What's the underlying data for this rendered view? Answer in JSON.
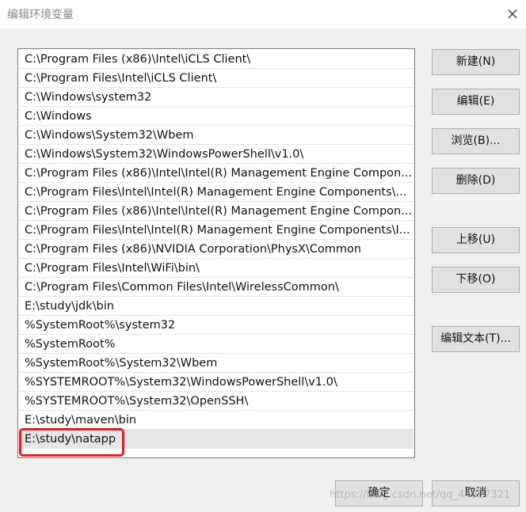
{
  "window": {
    "title": "编辑环境变量",
    "close_glyph": "×"
  },
  "paths": [
    "C:\\Program Files (x86)\\Intel\\iCLS Client\\",
    "C:\\Program Files\\Intel\\iCLS Client\\",
    "C:\\Windows\\system32",
    "C:\\Windows",
    "C:\\Windows\\System32\\Wbem",
    "C:\\Windows\\System32\\WindowsPowerShell\\v1.0\\",
    "C:\\Program Files (x86)\\Intel\\Intel(R) Management Engine Compon...",
    "C:\\Program Files\\Intel\\Intel(R) Management Engine Components\\...",
    "C:\\Program Files (x86)\\Intel\\Intel(R) Management Engine Compon...",
    "C:\\Program Files\\Intel\\Intel(R) Management Engine Components\\I...",
    "C:\\Program Files (x86)\\NVIDIA Corporation\\PhysX\\Common",
    "C:\\Program Files\\Intel\\WiFi\\bin\\",
    "C:\\Program Files\\Common Files\\Intel\\WirelessCommon\\",
    "E:\\study\\jdk\\bin",
    "%SystemRoot%\\system32",
    "%SystemRoot%",
    "%SystemRoot%\\System32\\Wbem",
    "%SYSTEMROOT%\\System32\\WindowsPowerShell\\v1.0\\",
    "%SYSTEMROOT%\\System32\\OpenSSH\\",
    "E:\\study\\maven\\bin",
    "E:\\study\\natapp"
  ],
  "selected_index": 20,
  "buttons": {
    "new": "新建(N)",
    "edit": "编辑(E)",
    "browse": "浏览(B)...",
    "delete": "删除(D)",
    "move_up": "上移(U)",
    "move_down": "下移(O)",
    "edit_text": "编辑文本(T)...",
    "ok": "确定",
    "cancel": "取消"
  },
  "watermark": "https://blog.csdn.net/qq_44917321",
  "colors": {
    "highlight_border": "#e41f1f",
    "selected_row": "#e6e6e6",
    "dialog_bg": "#f0f0f0"
  }
}
